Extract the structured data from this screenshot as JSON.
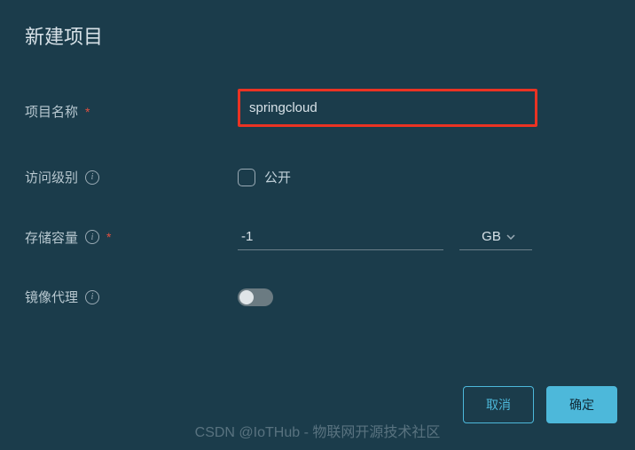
{
  "dialog": {
    "title": "新建项目"
  },
  "form": {
    "projectName": {
      "label": "项目名称",
      "value": "springcloud"
    },
    "accessLevel": {
      "label": "访问级别",
      "checkboxLabel": "公开"
    },
    "storageCapacity": {
      "label": "存储容量",
      "value": "-1",
      "unit": "GB"
    },
    "imageProxy": {
      "label": "镜像代理"
    }
  },
  "buttons": {
    "cancel": "取消",
    "confirm": "确定"
  },
  "watermark": "CSDN @IoTHub - 物联网开源技术社区"
}
